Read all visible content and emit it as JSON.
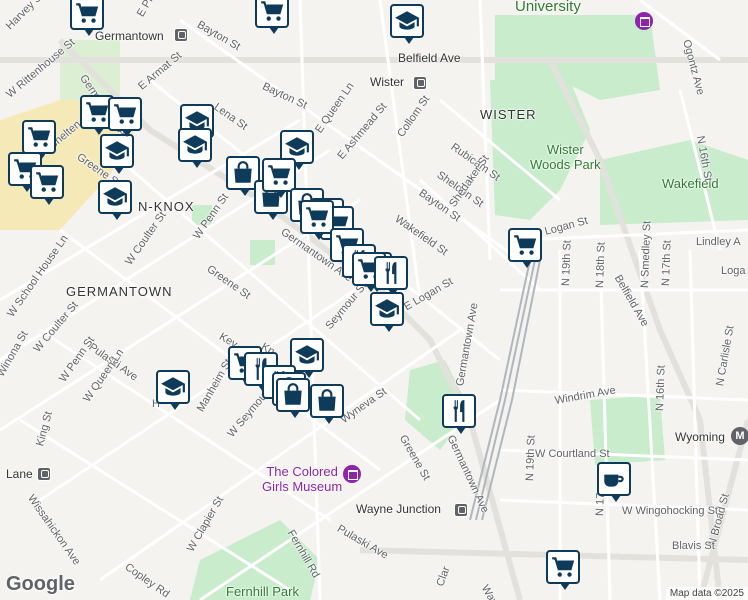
{
  "colors": {
    "water": "#aadaff",
    "park": "#c8eccc",
    "road": "#ffffff",
    "major_road": "#e8e8e8",
    "marker_border": "#0f3b5a",
    "campus": "#f6e9b8"
  },
  "labels": {
    "university": "University",
    "harvey_st": "Harvey St",
    "w_rittenhouse_st": "W Rittenhouse St",
    "germantown_top": "Germantown",
    "bayton_st_top": "Bayton St",
    "e_price_st": "E Price St",
    "belfield_ave": "Belfield Ave",
    "wister_station": "Wister",
    "wister_area": "WISTER",
    "e_armat_st": "E Armat St",
    "germantown_ave_nw": "Germantown Ave",
    "bayton_st": "Bayton St",
    "lena_st": "Lena St",
    "e_queen_ln": "E Queen Ln",
    "e_ashmead_st": "E Ashmead St",
    "collom_st": "Collom St",
    "rubicam_st": "Rubicam St",
    "sheldon_st": "Sheldon St",
    "wister_woods_park": "Wister\nWoods Park",
    "wakefield": "Wakefield",
    "n_16th_st": "N 16th St",
    "w_chelten": "W Chelten",
    "greene_st_nw": "Greene St",
    "penn_knox": "N-KNOX",
    "bayton_st_mid": "Bayton St",
    "shedaker_st": "Shedaker St",
    "wakefield_st": "Wakefield St",
    "w_penn_st": "W Penn St",
    "w_coulter_st": "W Coulter St",
    "germantown_ave_mid": "Germantown Ave",
    "lindley_ave": "Lindley A",
    "logan_st_e": "Logan St",
    "logan": "Loga",
    "greene_st": "Greene St",
    "germantown_area": "GERMANTOWN",
    "w_school_house_ln": "W School House Ln",
    "e_logan_st": "E Logan St",
    "seymour_st": "Seymour St",
    "n_19th_st": "N 19th St",
    "n_18th_st": "N 18th St",
    "n_17th_st": "N 17th St",
    "n_smedley_st": "N Smedley St",
    "belfield_ave_se": "Belfield Ave",
    "w_coulter_st_sw": "W Coulter St",
    "pulaski_ave": "Pulaski Ave",
    "winona_st": "Winona St",
    "w_penn_st_sw": "W Penn St",
    "w_queen_ln": "W Queen Ln",
    "keyser": "Key",
    "knox": "Kn",
    "manheim_st": "Manheim St",
    "h_st": "H",
    "wyneva_st": "Wyneva St",
    "greene_st_s": "Greene St",
    "germantown_ave_s": "Germantown Ave",
    "windrim_ave": "Windrim Ave",
    "n_16th_st_se": "N 16th St",
    "n_carlisle_st": "N Carlisle St",
    "wyoming": "Wyoming",
    "w_courtland_st": "W Courtland St",
    "n_19th_st_s": "N 19th St",
    "w_wingohocking_st": "W Wingohocking St",
    "n_broad_st": "N Broad St",
    "w_seymour_st": "W Seymour St",
    "king_st": "King St",
    "lane": "Lane",
    "colored_girls_museum": "The Colored\nGirls Museum",
    "wayne_junction": "Wayne Junction",
    "fernhill_rd": "Fernhill Rd",
    "pulaski_ave_s": "Pulaski Ave",
    "wissahickon_ave": "Wissahickon Ave",
    "w_clapier_st": "W Clapier St",
    "copley_rd": "Copley Rd",
    "fernhill_park": "Fernhill Park",
    "blavis_st": "Blavis St",
    "n_17th_s": "N 17",
    "clar": "Clar",
    "wayn": "Wayn",
    "ogontz_ave": "Ogontz Ave",
    "n_16th_st_ne": "N 16th St"
  },
  "google_logo": "Google",
  "attribution": "Map data ©2025",
  "markers": [
    {
      "type": "cart"
    },
    {
      "type": "cart"
    },
    {
      "type": "cart"
    },
    {
      "type": "cart"
    },
    {
      "type": "cart"
    },
    {
      "type": "cart"
    },
    {
      "type": "school"
    },
    {
      "type": "school"
    },
    {
      "type": "school"
    },
    {
      "type": "school"
    },
    {
      "type": "school"
    },
    {
      "type": "bag"
    },
    {
      "type": "bag"
    },
    {
      "type": "fork"
    },
    {
      "type": "fork"
    },
    {
      "type": "cup"
    }
  ]
}
